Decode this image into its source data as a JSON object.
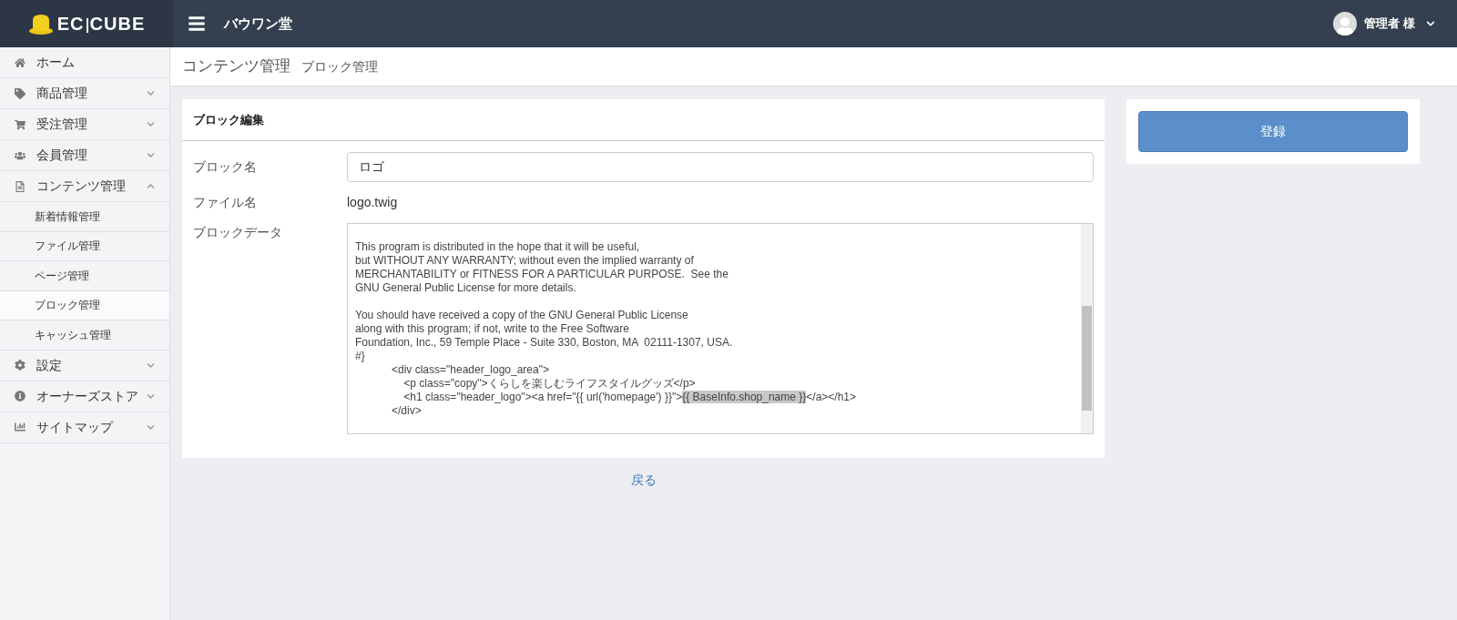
{
  "header": {
    "logo": [
      "EC",
      "CUBE"
    ],
    "shop_name": "バウワン堂",
    "user": "管理者 様"
  },
  "sidebar": {
    "items": [
      {
        "label": "ホーム"
      },
      {
        "label": "商品管理",
        "expanded": false
      },
      {
        "label": "受注管理",
        "expanded": false
      },
      {
        "label": "会員管理",
        "expanded": false
      },
      {
        "label": "コンテンツ管理",
        "expanded": true,
        "children": [
          {
            "label": "新着情報管理",
            "selected": false
          },
          {
            "label": "ファイル管理",
            "selected": false
          },
          {
            "label": "ページ管理",
            "selected": false
          },
          {
            "label": "ブロック管理",
            "selected": true
          },
          {
            "label": "キャッシュ管理",
            "selected": false
          }
        ]
      },
      {
        "label": "設定",
        "expanded": false
      },
      {
        "label": "オーナーズストア",
        "expanded": false
      },
      {
        "label": "サイトマップ",
        "expanded": false
      }
    ]
  },
  "breadcrumb": [
    "コンテンツ管理",
    "ブロック管理"
  ],
  "card": {
    "title": "ブロック編集",
    "block_name": {
      "label": "ブロック名",
      "value": "ロゴ"
    },
    "file_name": {
      "label": "ファイル名",
      "value": "logo.twig"
    },
    "block_data": {
      "label": "ブロックデータ",
      "paragraphs": [
        [
          {
            "text": "This program is distributed in the hope that it will be useful,"
          },
          {
            "text": "but WITHOUT ANY WARRANTY; without even the implied warranty of"
          },
          {
            "text": "MERCHANTABILITY or FITNESS FOR A PARTICULAR PURPOSE.  See the"
          },
          {
            "text": "GNU General Public License for more details."
          }
        ],
        [
          {
            "text": "You should have received a copy of the GNU General Public License"
          },
          {
            "text": "along with this program; if not, write to the Free Software"
          },
          {
            "text": "Foundation, Inc., 59 Temple Place - Suite 330, Boston, MA  02111-1307, USA."
          },
          {
            "text": "#}"
          },
          {
            "text": "            <div class=\"header_logo_area\">"
          },
          {
            "text": "                <p class=\"copy\">くらしを楽しむライフスタイルグッズ</p>"
          },
          {
            "text": "                <h1 class=\"header_logo\"><a href=\"{{ url('homepage') }}\">",
            "highlight": "{{ BaseInfo.shop_name }}",
            "after": "</a></h1>"
          },
          {
            "text": "            </div>"
          }
        ]
      ]
    }
  },
  "back_link": "戻る",
  "register_button": "登録"
}
